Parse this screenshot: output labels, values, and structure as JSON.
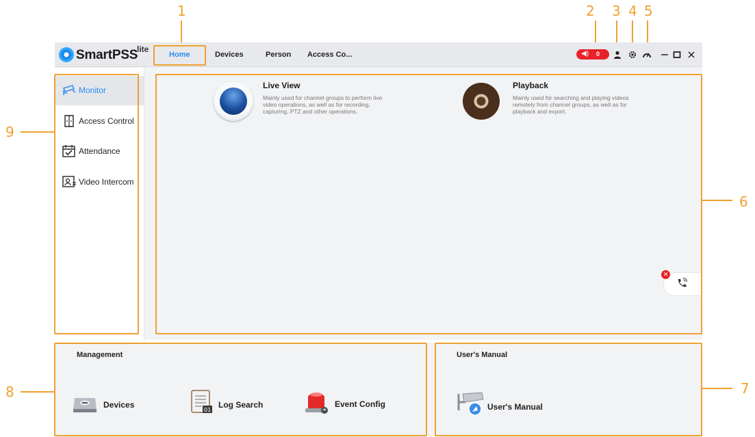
{
  "callouts": [
    "1",
    "2",
    "3",
    "4",
    "5",
    "6",
    "7",
    "8",
    "9"
  ],
  "app": {
    "name": "SmartPSS",
    "suffix": "lite"
  },
  "nav_tabs": [
    {
      "label": "Home",
      "active": true
    },
    {
      "label": "Devices",
      "active": false
    },
    {
      "label": "Person",
      "active": false
    },
    {
      "label": "Access Co...",
      "active": false
    }
  ],
  "toolbar": {
    "alarm_count": "0",
    "icons": [
      "speaker-icon",
      "user-icon",
      "gear-icon",
      "gauge-icon",
      "minimize-icon",
      "maximize-icon",
      "close-icon"
    ]
  },
  "sidebar": {
    "collapse_glyph": "‹",
    "items": [
      {
        "label": "Monitor",
        "icon": "monitor-camera-icon",
        "active": true
      },
      {
        "label": "Access Control",
        "icon": "door-icon",
        "active": false
      },
      {
        "label": "Attendance",
        "icon": "calendar-check-icon",
        "active": false
      },
      {
        "label": "Video Intercom",
        "icon": "intercom-icon",
        "active": false
      }
    ]
  },
  "modules": [
    {
      "title": "Live View",
      "description": "Mainly used for channel groups to perform live video operations, as well as for recording, capturing, PTZ and other operations.",
      "icon": "live-view-icon"
    },
    {
      "title": "Playback",
      "description": "Mainly used for searching and playing videos remotely from channel groups, as well as for playback and export.",
      "icon": "film-reel-icon"
    }
  ],
  "management": {
    "title": "Management",
    "items": [
      {
        "label": "Devices",
        "icon": "device-icon"
      },
      {
        "label": "Log Search",
        "icon": "log-icon"
      },
      {
        "label": "Event Config",
        "icon": "alarm-light-icon"
      }
    ]
  },
  "manual": {
    "title": "User's Manual",
    "item_label": "User's Manual",
    "icon": "manual-camera-icon"
  },
  "colors": {
    "accent": "#2a8ef0",
    "callout": "#f0a030",
    "alarm": "#e8222a",
    "window_bg": "#f2f3f5"
  }
}
